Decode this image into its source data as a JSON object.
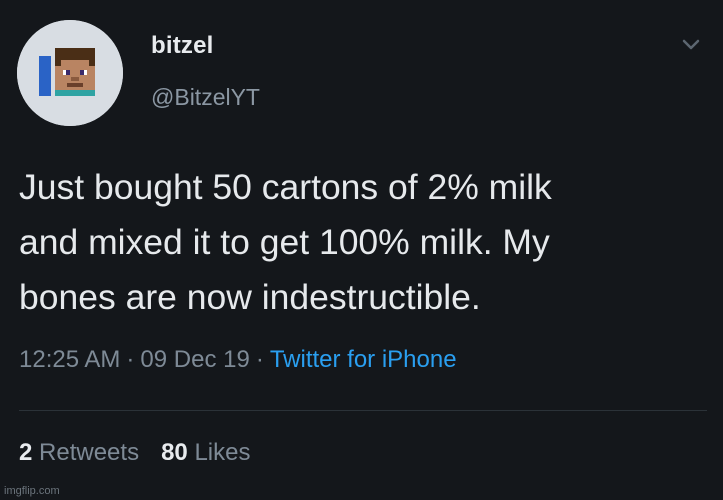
{
  "tweet": {
    "display_name": "bitzel",
    "handle": "@BitzelYT",
    "text_lines": [
      "Just bought 50 cartons of 2% milk",
      "and mixed it to get 100% milk. My",
      "bones are now indestructible."
    ],
    "time": "12:25 AM",
    "separator": "·",
    "date": "09 Dec 19",
    "source": "Twitter for iPhone",
    "retweets_count": "2",
    "retweets_label": "Retweets",
    "likes_count": "80",
    "likes_label": "Likes",
    "icons": {
      "avatar": "minecraft-avatar",
      "menu": "chevron-down-icon"
    },
    "colors": {
      "background": "#14171b",
      "link": "#2a9ff0",
      "muted": "#7e8a96"
    }
  },
  "watermark": "imgflip.com"
}
